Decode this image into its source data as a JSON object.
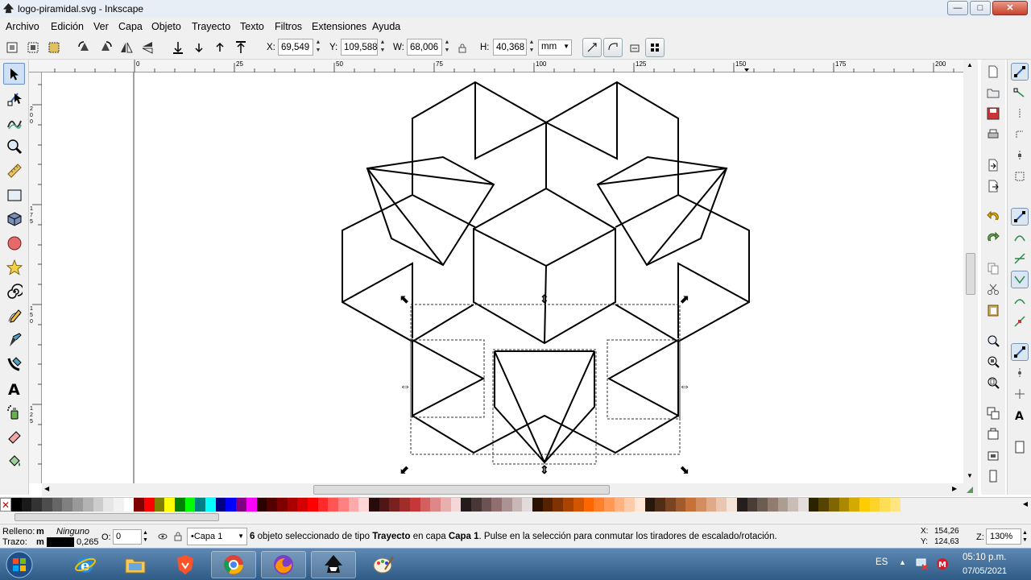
{
  "window": {
    "title": "logo-piramidal.svg - Inkscape",
    "controls": {
      "minimize": "—",
      "maximize": "□",
      "close": "✕"
    }
  },
  "menu": [
    "Archivo",
    "Edición",
    "Ver",
    "Capa",
    "Objeto",
    "Trayecto",
    "Texto",
    "Filtros",
    "Extensiones",
    "Ayuda"
  ],
  "tool_controls": {
    "x_label": "X:",
    "x_value": "69,549",
    "y_label": "Y:",
    "y_value": "109,588",
    "w_label": "W:",
    "w_value": "68,006",
    "h_label": "H:",
    "h_value": "40,368",
    "unit": "mm"
  },
  "ruler": {
    "h_ticks": [
      "0",
      "25",
      "50",
      "75",
      "100",
      "125",
      "150",
      "175",
      "200"
    ],
    "v_ticks": [
      "200",
      "175",
      "150",
      "125"
    ]
  },
  "palette_colors": [
    "#000000",
    "#1a1a1a",
    "#333333",
    "#4d4d4d",
    "#666666",
    "#808080",
    "#999999",
    "#b3b3b3",
    "#cccccc",
    "#e6e6e6",
    "#f2f2f2",
    "#ffffff",
    "#800000",
    "#ff0000",
    "#808000",
    "#ffff00",
    "#008000",
    "#00ff00",
    "#008080",
    "#00ffff",
    "#000080",
    "#0000ff",
    "#800080",
    "#ff00ff",
    "#2b0000",
    "#550000",
    "#800000",
    "#aa0000",
    "#d40000",
    "#ff0000",
    "#ff2a2a",
    "#ff5555",
    "#ff8080",
    "#ffaaaa",
    "#ffd5d5",
    "#280b0b",
    "#501616",
    "#782121",
    "#a02c2c",
    "#c83737",
    "#d35f5f",
    "#de8787",
    "#e9afaf",
    "#f4d7d7",
    "#241c1c",
    "#483737",
    "#6c5353",
    "#916f6f",
    "#ac9393",
    "#c8b7b7",
    "#e3dbdb",
    "#2b1100",
    "#552200",
    "#803300",
    "#aa4400",
    "#d45500",
    "#ff6600",
    "#ff7f2a",
    "#ff9955",
    "#ffb380",
    "#ffccaa",
    "#ffe6d5",
    "#28170b",
    "#502d16",
    "#784421",
    "#a05a2c",
    "#c87137",
    "#d38d5f",
    "#deaa87",
    "#e9c6af",
    "#f4e3d7",
    "#241f1c",
    "#483e37",
    "#6c5d53",
    "#917c6f",
    "#ac9d93",
    "#c8beb7",
    "#e3dedb",
    "#2b2200",
    "#554400",
    "#806600",
    "#aa8800",
    "#d4aa00",
    "#ffcc00",
    "#ffd42a",
    "#ffdd55",
    "#ffe680"
  ],
  "status": {
    "fill_label": "Relleno:",
    "fill_marker": "m",
    "fill_value": "Ninguno",
    "stroke_label": "Trazo:",
    "stroke_marker": "m",
    "stroke_width": "0,265",
    "opacity_label": "O:",
    "opacity_value": "0",
    "layer": "•Capa 1",
    "message_count": "6",
    "message_part1": " objeto seleccionado de tipo ",
    "message_type": "Trayecto",
    "message_part2": " en capa ",
    "message_layer": "Capa 1",
    "message_part3": ". Pulse en la selección para conmutar los tiradores de escalado/rotación.",
    "cursor_x_label": "X:",
    "cursor_x": "154,26",
    "cursor_y_label": "Y:",
    "cursor_y": "124,63",
    "zoom_label": "Z:",
    "zoom_value": "130%"
  },
  "taskbar": {
    "apps": [
      "start-orb-icon",
      "internet-explorer-icon",
      "file-explorer-icon",
      "brave-icon",
      "chrome-icon",
      "firefox-icon",
      "inkscape-icon",
      "paint-icon"
    ],
    "tray_lang": "ES",
    "time": "05:10 p.m.",
    "date": "07/05/2021"
  }
}
